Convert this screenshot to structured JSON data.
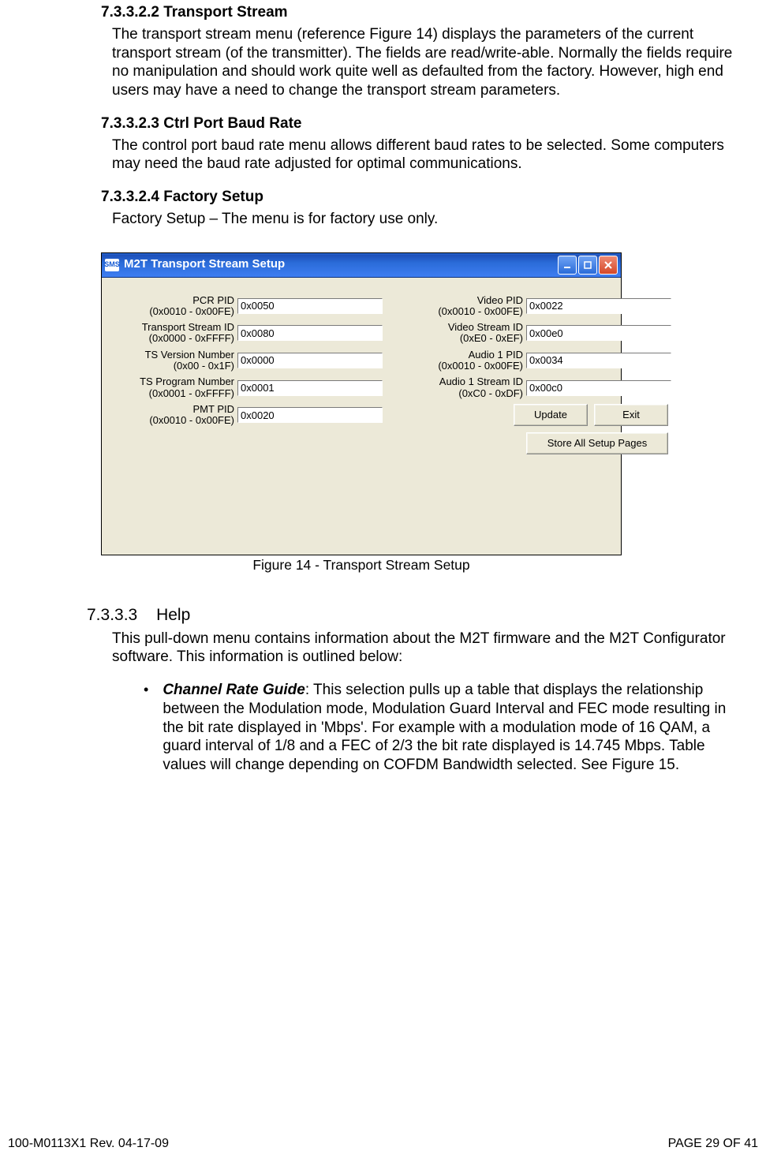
{
  "sections": {
    "s1": {
      "heading": "7.3.3.2.2 Transport Stream",
      "body": "The transport stream menu (reference Figure 14) displays the parameters of the current transport stream (of the transmitter). The fields are read/write-able. Normally the fields require no manipulation and should work quite well as defaulted from the factory. However, high end users may have a need to change the transport stream parameters."
    },
    "s2": {
      "heading": "7.3.3.2.3 Ctrl Port Baud Rate",
      "body": "The control port baud rate menu allows different baud rates to be selected. Some computers may need the baud rate adjusted for optimal communications."
    },
    "s3": {
      "heading": "7.3.3.2.4 Factory Setup",
      "body": "Factory Setup – The menu is for factory use only."
    },
    "help": {
      "num": "7.3.3.3",
      "title": "Help",
      "body": "This pull-down menu contains information about the M2T firmware and the M2T Configurator software. This information is outlined below:",
      "bullet_lead": "Channel Rate Guide",
      "bullet_rest": ": This selection pulls up a table that displays the relationship between the Modulation mode, Modulation Guard Interval and FEC mode resulting in the bit rate displayed in 'Mbps'. For example with a modulation mode of 16 QAM, a guard interval of 1/8 and a FEC of 2/3 the bit rate displayed is 14.745 Mbps. Table values will change depending on COFDM Bandwidth selected.  See Figure 15."
    }
  },
  "figure": {
    "title_icon": "SMS",
    "window_title": "M2T Transport Stream Setup",
    "caption": "Figure 14 - Transport Stream Setup",
    "left": [
      {
        "label1": "PCR PID",
        "label2": "(0x0010 - 0x00FE)",
        "value": "0x0050"
      },
      {
        "label1": "Transport Stream ID",
        "label2": "(0x0000 - 0xFFFF)",
        "value": "0x0080"
      },
      {
        "label1": "TS Version Number",
        "label2": "(0x00 - 0x1F)",
        "value": "0x0000"
      },
      {
        "label1": "TS Program Number",
        "label2": "(0x0001 - 0xFFFF)",
        "value": "0x0001"
      },
      {
        "label1": "PMT PID",
        "label2": "(0x0010 - 0x00FE)",
        "value": "0x0020"
      }
    ],
    "right": [
      {
        "label1": "Video PID",
        "label2": "(0x0010 - 0x00FE)",
        "value": "0x0022"
      },
      {
        "label1": "Video Stream ID",
        "label2": "(0xE0 - 0xEF)",
        "value": "0x00e0"
      },
      {
        "label1": "Audio 1 PID",
        "label2": "(0x0010 - 0x00FE)",
        "value": "0x0034"
      },
      {
        "label1": "Audio 1 Stream ID",
        "label2": "(0xC0 - 0xDF)",
        "value": "0x00c0"
      }
    ],
    "buttons": {
      "update": "Update",
      "exit": "Exit",
      "store": "Store All Setup Pages"
    }
  },
  "footer": {
    "left": "100-M0113X1 Rev. 04-17-09",
    "right": "PAGE 29 OF 41"
  }
}
